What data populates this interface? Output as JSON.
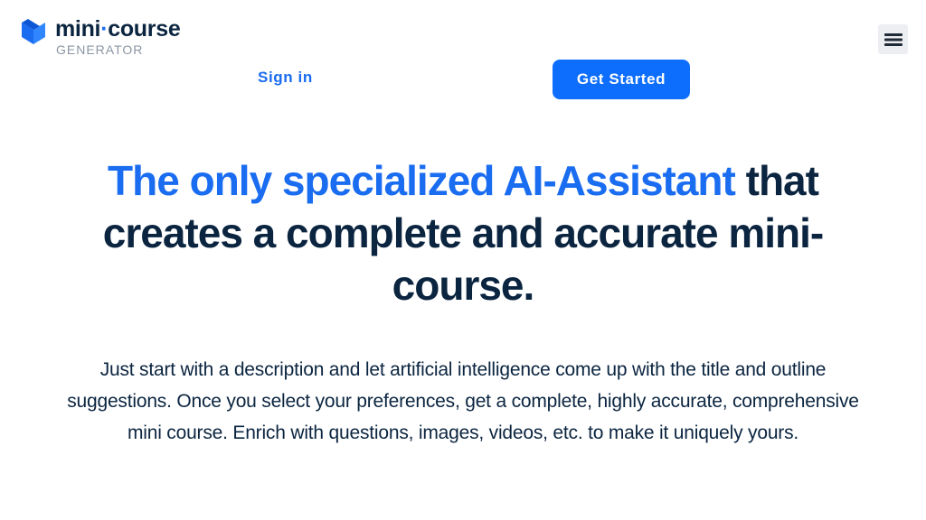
{
  "header": {
    "logo_main_1": "mini",
    "logo_dot": "·",
    "logo_main_2": "course",
    "logo_sub": "GENERATOR",
    "menu_icon": "hamburger-menu-icon"
  },
  "nav": {
    "signin_label": "Sign in",
    "get_started_label": "Get Started"
  },
  "hero": {
    "headline_highlight": "The only specialized AI-Assistant",
    "headline_rest": " that creates a complete and accurate mini-course.",
    "description": "Just start with a description and let artificial intelligence come up with the title and outline suggestions. Once you select your preferences, get a complete, highly accurate, comprehensive mini course. Enrich with questions, images, videos, etc. to make it uniquely yours."
  },
  "colors": {
    "accent": "#1a6cf0",
    "button": "#0d6efd",
    "text": "#0b2540"
  }
}
